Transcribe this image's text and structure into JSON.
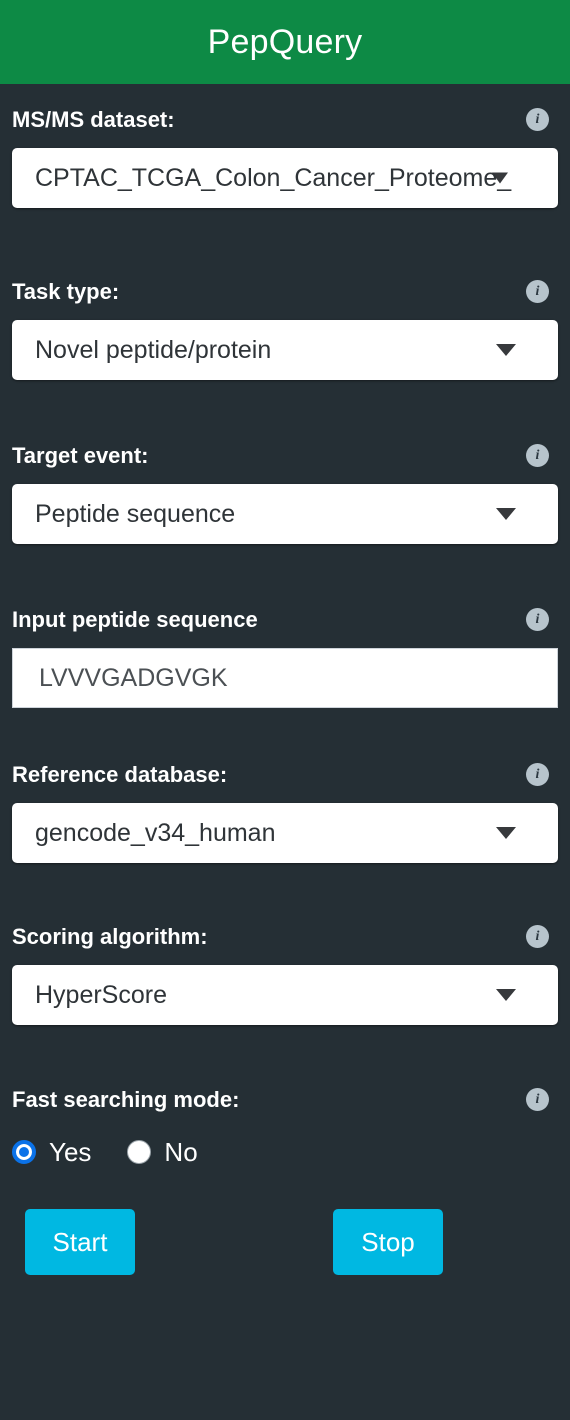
{
  "header": {
    "title": "PepQuery",
    "background_color": "#0d8a45"
  },
  "theme": {
    "page_background": "#252f35",
    "button_color": "#00b8e2",
    "radio_selected_color": "#0b72e8",
    "info_icon_color": "#b7c4cc"
  },
  "info_icon_glyph": "i",
  "fields": {
    "dataset": {
      "label": "MS/MS dataset:",
      "value": "CPTAC_TCGA_Colon_Cancer_Proteome_",
      "icon": "info-icon"
    },
    "task_type": {
      "label": "Task type:",
      "value": "Novel peptide/protein",
      "icon": "info-icon"
    },
    "target_event": {
      "label": "Target event:",
      "value": "Peptide sequence",
      "icon": "info-icon"
    },
    "peptide_sequence": {
      "label": "Input peptide sequence",
      "value": "LVVVGADGVGK",
      "icon": "info-icon"
    },
    "reference_database": {
      "label": "Reference database:",
      "value": "gencode_v34_human",
      "icon": "info-icon"
    },
    "scoring_algorithm": {
      "label": "Scoring algorithm:",
      "value": "HyperScore",
      "icon": "info-icon"
    },
    "fast_searching_mode": {
      "label": "Fast searching mode:",
      "icon": "info-icon",
      "options": [
        {
          "label": "Yes",
          "selected": true
        },
        {
          "label": "No",
          "selected": false
        }
      ]
    }
  },
  "actions": {
    "start_label": "Start",
    "stop_label": "Stop"
  }
}
